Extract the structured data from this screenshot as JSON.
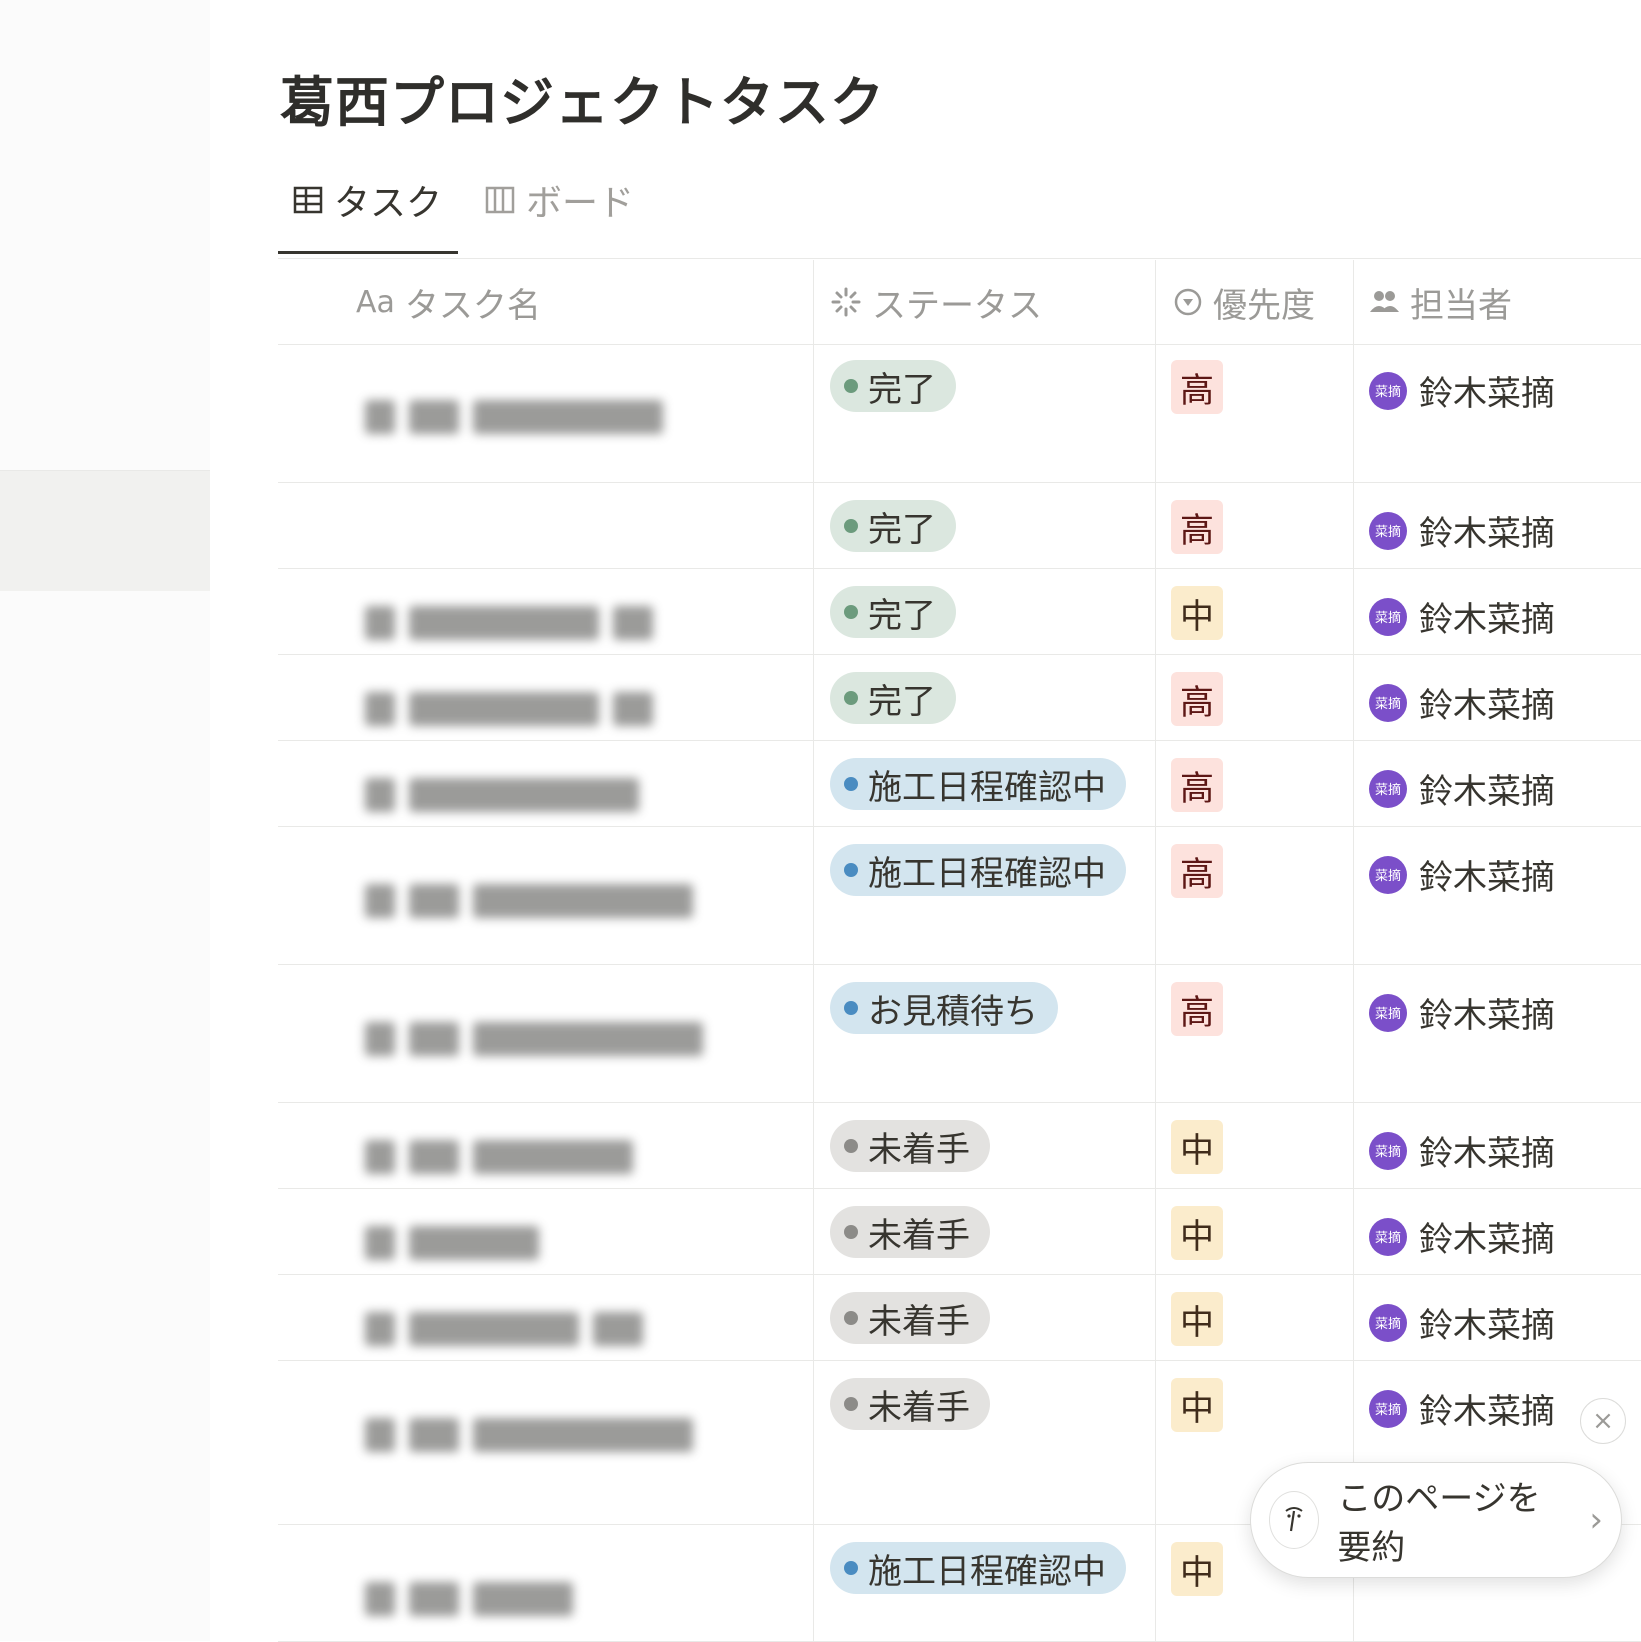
{
  "title": "葛西プロジェクトタスク",
  "tabs": [
    {
      "label": "タスク",
      "icon": "table-icon",
      "active": true
    },
    {
      "label": "ボード",
      "icon": "board-icon",
      "active": false
    }
  ],
  "columns": {
    "name": {
      "label": "タスク名",
      "icon": "Aa"
    },
    "status": {
      "label": "ステータス",
      "icon": "status-spinner-icon"
    },
    "priority": {
      "label": "優先度",
      "icon": "priority-icon"
    },
    "assignee": {
      "label": "担当者",
      "icon": "people-icon"
    }
  },
  "rows": [
    {
      "status": "完了",
      "priority": "高",
      "assignee": "鈴木菜摘",
      "avatar": "菜摘"
    },
    {
      "status": "完了",
      "priority": "高",
      "assignee": "鈴木菜摘",
      "avatar": "菜摘"
    },
    {
      "status": "完了",
      "priority": "中",
      "assignee": "鈴木菜摘",
      "avatar": "菜摘"
    },
    {
      "status": "完了",
      "priority": "高",
      "assignee": "鈴木菜摘",
      "avatar": "菜摘"
    },
    {
      "status": "施工日程確認中",
      "priority": "高",
      "assignee": "鈴木菜摘",
      "avatar": "菜摘"
    },
    {
      "status": "施工日程確認中",
      "priority": "高",
      "assignee": "鈴木菜摘",
      "avatar": "菜摘"
    },
    {
      "status": "お見積待ち",
      "priority": "高",
      "assignee": "鈴木菜摘",
      "avatar": "菜摘"
    },
    {
      "status": "未着手",
      "priority": "中",
      "assignee": "鈴木菜摘",
      "avatar": "菜摘"
    },
    {
      "status": "未着手",
      "priority": "中",
      "assignee": "鈴木菜摘",
      "avatar": "菜摘"
    },
    {
      "status": "未着手",
      "priority": "中",
      "assignee": "鈴木菜摘",
      "avatar": "菜摘"
    },
    {
      "status": "未着手",
      "priority": "中",
      "assignee": "鈴木菜摘",
      "avatar": "菜摘"
    },
    {
      "status": "施工日程確認中",
      "priority": "中",
      "assignee": "",
      "avatar": ""
    }
  ],
  "summary": {
    "label": "このページを要約",
    "close": "×"
  },
  "colors": {
    "done_bg": "#dbe7df",
    "done_dot": "#6c9b7d",
    "inprog_bg": "#d3e5ef",
    "inprog_dot": "#4a8cc1",
    "todo_bg": "#e3e2e0",
    "todo_dot": "#8c8b88",
    "high_bg": "#fde2dd",
    "high_fg": "#5d1715",
    "mid_bg": "#fbeccc",
    "mid_fg": "#402c1b",
    "avatar": "#7b4fc9"
  }
}
